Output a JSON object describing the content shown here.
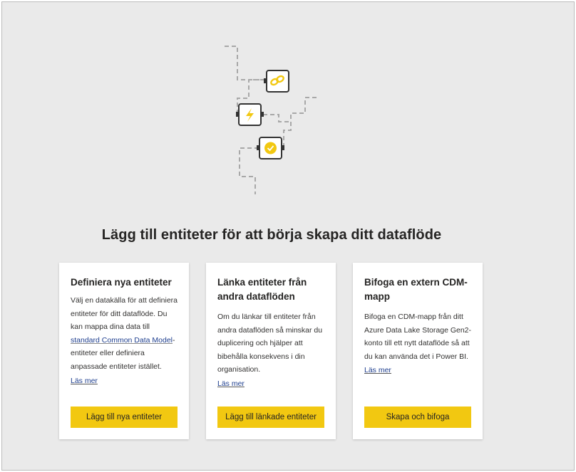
{
  "headline": "Lägg till entiteter för att börja skapa ditt dataflöde",
  "illustration": {
    "icons": [
      "link-icon",
      "lightning-icon",
      "certified-badge-icon"
    ],
    "accent_color": "#f2c811"
  },
  "cards": [
    {
      "title": "Definiera nya entiteter",
      "desc_before_link": "Välj en datakälla för att definiera entiteter för ditt dataflöde. Du kan mappa dina data till ",
      "desc_link": "standard Common Data Model",
      "desc_after_link": "-entiteter eller definiera anpassade entiteter istället.",
      "learn_more": "Läs mer",
      "button": "Lägg till nya entiteter"
    },
    {
      "title": "Länka entiteter från andra dataflöden",
      "desc": "Om du länkar till entiteter från andra dataflöden så minskar du duplicering och hjälper att bibehålla konsekvens i din organisation.",
      "learn_more": "Läs mer",
      "button": "Lägg till länkade entiteter"
    },
    {
      "title": "Bifoga en extern CDM-mapp",
      "desc": "Bifoga en CDM-mapp från ditt Azure Data Lake Storage Gen2-konto till ett nytt dataflöde så att du kan använda det i Power BI.",
      "learn_more": "Läs mer",
      "button": "Skapa och bifoga"
    }
  ],
  "colors": {
    "button": "#f2c811",
    "link": "#1f3f8f",
    "background": "#eaeaea"
  }
}
